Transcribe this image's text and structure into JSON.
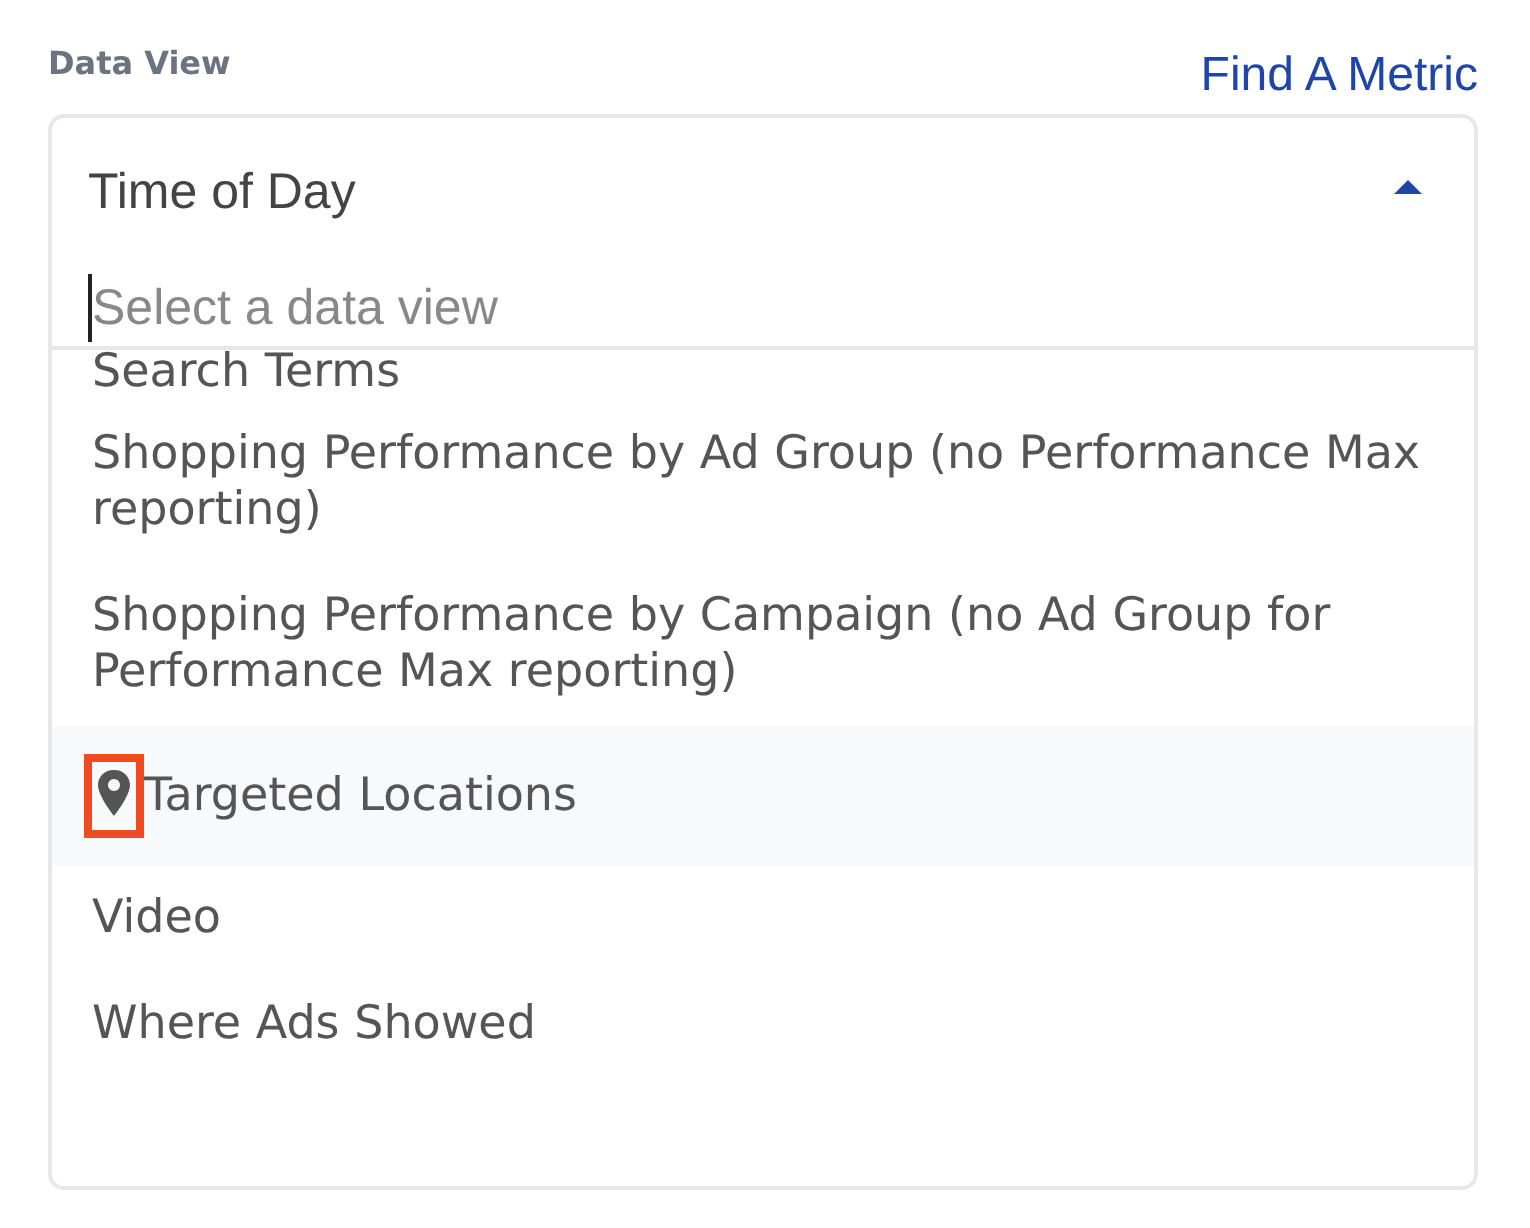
{
  "field_label": "Data View",
  "link": "Find A Metric",
  "dropdown": {
    "value": "Time of Day",
    "expanded": true,
    "search": {
      "placeholder": "Select a data view"
    },
    "options": [
      {
        "label": "Search Terms",
        "kind": "plain",
        "hovered": false,
        "annotated": false
      },
      {
        "label": "Shopping Performance by Ad Group (no Performance Max reporting)",
        "kind": "plain",
        "hovered": false,
        "annotated": false
      },
      {
        "label": "Shopping Performance by Campaign (no Ad Group for Performance Max reporting)",
        "kind": "plain",
        "hovered": false,
        "annotated": false
      },
      {
        "label": "Targeted Locations",
        "kind": "location",
        "hovered": true,
        "annotated": true
      },
      {
        "label": "Video",
        "kind": "plain",
        "hovered": false,
        "annotated": false
      },
      {
        "label": "Where Ads Showed",
        "kind": "plain",
        "hovered": false,
        "annotated": false
      }
    ]
  }
}
